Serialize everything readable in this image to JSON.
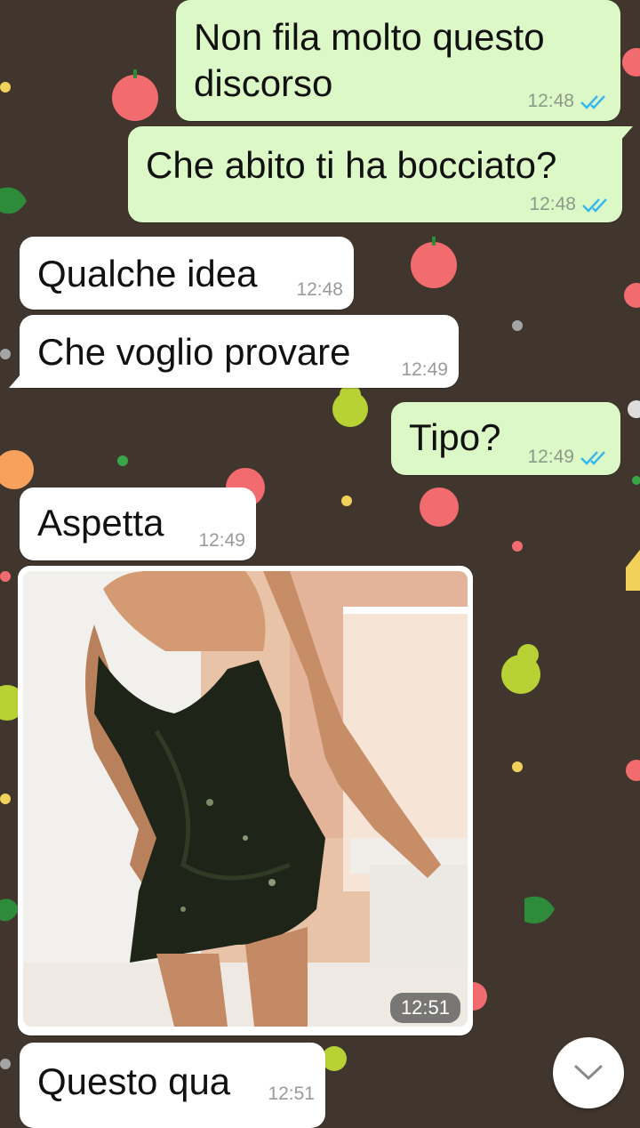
{
  "messages": [
    {
      "id": "m1",
      "direction": "outgoing",
      "text_line1": "Non fila molto questo",
      "text_line2": "discorso",
      "time": "12:48",
      "status_icon": "double-check-icon"
    },
    {
      "id": "m2",
      "direction": "outgoing",
      "text": "Che abito ti ha bocciato?",
      "time": "12:48",
      "status_icon": "double-check-icon"
    },
    {
      "id": "m3",
      "direction": "incoming",
      "text": "Qualche idea",
      "time": "12:48"
    },
    {
      "id": "m4",
      "direction": "incoming",
      "text": "Che voglio provare",
      "time": "12:49"
    },
    {
      "id": "m5",
      "direction": "outgoing",
      "text": "Tipo?",
      "time": "12:49",
      "status_icon": "double-check-icon"
    },
    {
      "id": "m6",
      "direction": "incoming",
      "text": "Aspetta",
      "time": "12:49"
    },
    {
      "id": "m7",
      "direction": "incoming",
      "type": "image",
      "image_icon": "photo-woman-black-sequin-dress",
      "time": "12:51"
    },
    {
      "id": "m8",
      "direction": "incoming",
      "text": "Questo qua",
      "time": "12:51"
    }
  ],
  "scroll_button_icon": "chevron-down-icon",
  "colors": {
    "wallpaper": "#40362e",
    "outgoing_bubble": "#dcf8c6",
    "incoming_bubble": "#ffffff",
    "read_ticks": "#34b7f1"
  }
}
